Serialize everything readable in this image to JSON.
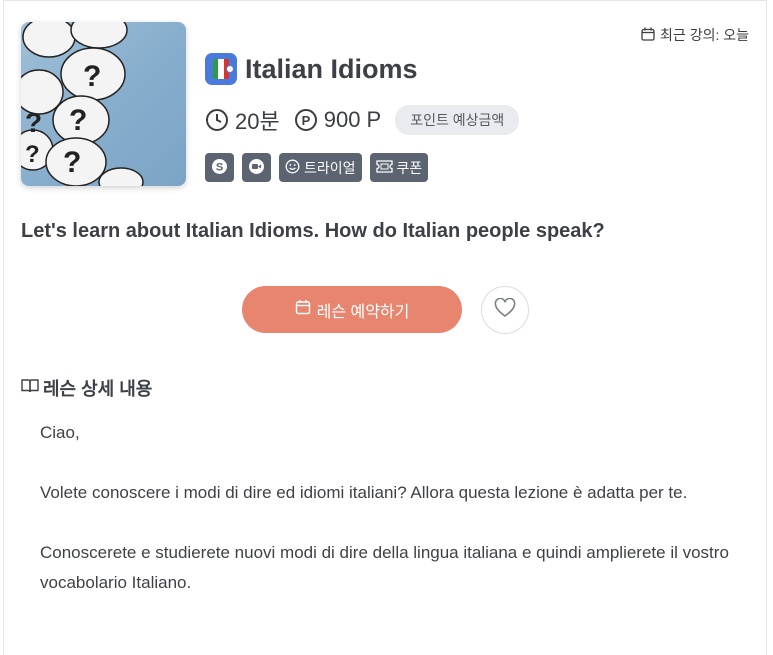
{
  "recent": {
    "label": "최근 강의: 오늘",
    "icon": "calendar-icon"
  },
  "course": {
    "title": "Italian Idioms",
    "duration": "20분",
    "points": "900 P",
    "points_estimate_label": "포인트 예상금액",
    "summary": "Let's learn about Italian Idioms. How do Italian people speak?"
  },
  "tags": {
    "skype": "S",
    "video": "video-call-icon",
    "trial": "트라이얼",
    "coupon": "쿠폰"
  },
  "actions": {
    "book_label": "레슨 예약하기",
    "favorite": "heart-icon"
  },
  "details": {
    "heading": "레슨 상세 내용",
    "paragraphs": [
      "Ciao,",
      "Volete conoscere i modi di dire ed idiomi italiani? Allora questa lezione è adatta per te.",
      "Conoscerete e studierete nuovi modi di dire della lingua italiana e quindi amplierete il vostro vocabolario Italiano."
    ]
  },
  "colors": {
    "accent": "#e8856f",
    "tag": "#5b6470",
    "badge": "#4a7bdc"
  }
}
